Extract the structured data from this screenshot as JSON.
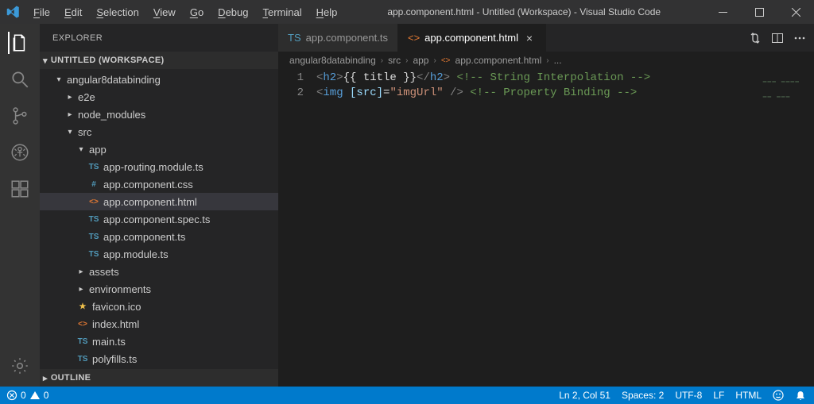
{
  "titlebar": {
    "title": "app.component.html - Untitled (Workspace) - Visual Studio Code",
    "menu": [
      "File",
      "Edit",
      "Selection",
      "View",
      "Go",
      "Debug",
      "Terminal",
      "Help"
    ]
  },
  "sidebar": {
    "header": "EXPLORER",
    "sections": {
      "workspace": {
        "label": "UNTITLED (WORKSPACE)"
      },
      "outline": {
        "label": "OUTLINE"
      }
    }
  },
  "tree": {
    "project": "angular8databinding",
    "folders": {
      "e2e": "e2e",
      "node_modules": "node_modules",
      "src": "src",
      "app": "app",
      "assets": "assets",
      "environments": "environments"
    },
    "files": {
      "app_routing": "app-routing.module.ts",
      "app_css": "app.component.css",
      "app_html": "app.component.html",
      "app_spec": "app.component.spec.ts",
      "app_ts": "app.component.ts",
      "app_module": "app.module.ts",
      "favicon": "favicon.ico",
      "index": "index.html",
      "main": "main.ts",
      "polyfills": "polyfills.ts"
    }
  },
  "tabs": [
    {
      "label": "app.component.ts",
      "icon": "ts",
      "active": false
    },
    {
      "label": "app.component.html",
      "icon": "html",
      "active": true
    }
  ],
  "breadcrumbs": [
    "angular8databinding",
    "src",
    "app",
    "app.component.html",
    "..."
  ],
  "editor": {
    "line_numbers": [
      "1",
      "2"
    ],
    "lines": [
      {
        "tokens": [
          {
            "cls": "tok-tag",
            "t": "<"
          },
          {
            "cls": "tok-name",
            "t": "h2"
          },
          {
            "cls": "tok-tag",
            "t": ">"
          },
          {
            "cls": "tok-white",
            "t": "{{ title }}"
          },
          {
            "cls": "tok-tag",
            "t": "</"
          },
          {
            "cls": "tok-name",
            "t": "h2"
          },
          {
            "cls": "tok-tag",
            "t": ">"
          },
          {
            "cls": "tok-cmt",
            "t": " <!-- String Interpolation -->"
          }
        ]
      },
      {
        "tokens": [
          {
            "cls": "tok-tag",
            "t": "<"
          },
          {
            "cls": "tok-name",
            "t": "img "
          },
          {
            "cls": "tok-attr",
            "t": "[src]"
          },
          {
            "cls": "tok-white",
            "t": "="
          },
          {
            "cls": "tok-str",
            "t": "\"imgUrl\""
          },
          {
            "cls": "tok-tag",
            "t": " />"
          },
          {
            "cls": "tok-cmt",
            "t": " <!-- Property Binding -->"
          }
        ]
      }
    ]
  },
  "statusbar": {
    "errors": "0",
    "warnings": "0",
    "ln_col": "Ln 2, Col 51",
    "spaces": "Spaces: 2",
    "encoding": "UTF-8",
    "eol": "LF",
    "lang": "HTML"
  },
  "colors": {
    "accent": "#007acc"
  }
}
